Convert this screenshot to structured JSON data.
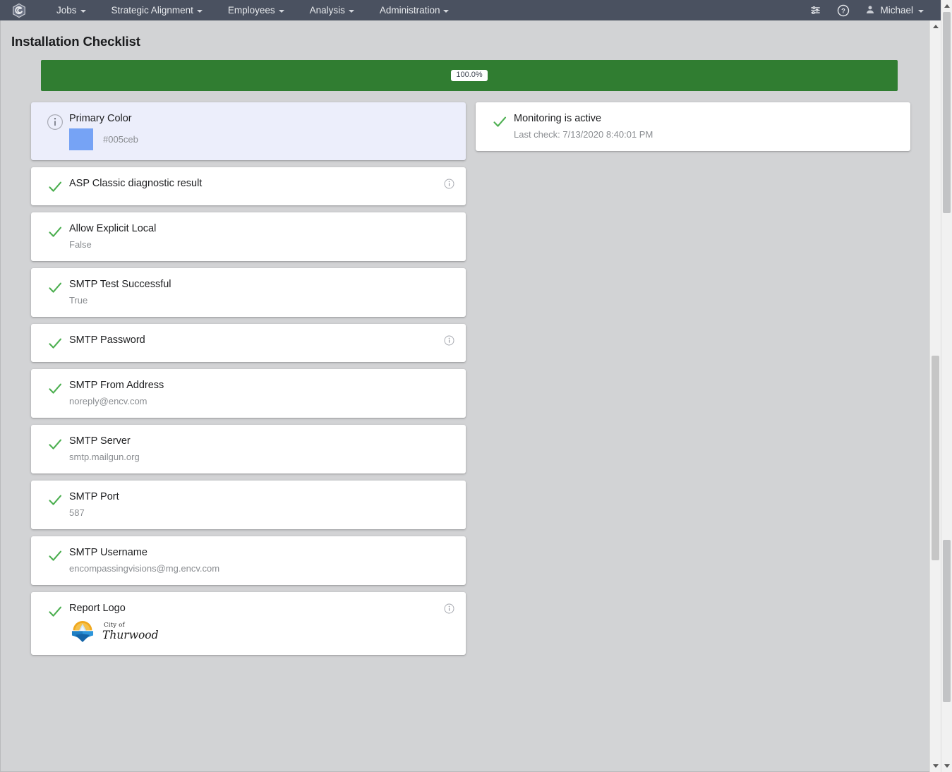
{
  "navbar": {
    "brand_icon": "hexagon-swirl-logo",
    "menus": [
      {
        "label": "Jobs",
        "icon": "chevron-down-icon"
      },
      {
        "label": "Strategic Alignment",
        "icon": "chevron-down-icon"
      },
      {
        "label": "Employees",
        "icon": "chevron-down-icon"
      },
      {
        "label": "Analysis",
        "icon": "chevron-down-icon"
      },
      {
        "label": "Administration",
        "icon": "chevron-down-icon"
      }
    ],
    "settings_icon": "sliders-icon",
    "help_icon": "help-circle-icon",
    "user": {
      "avatar_icon": "user-avatar-icon",
      "name": "Michael",
      "caret_icon": "chevron-down-icon"
    }
  },
  "page": {
    "title": "Installation Checklist"
  },
  "progress": {
    "label": "100.0%",
    "percent": 100,
    "bar_color": "#307d31",
    "badge_bg": "#ffffff"
  },
  "left_column": [
    {
      "name": "primary-color",
      "status_icon": "info-circle-icon",
      "title": "Primary Color",
      "value": "#005ceb",
      "swatch_color": "#76a3f5",
      "highlighted": true,
      "has_info": false
    },
    {
      "name": "asp-classic-diagnostic-result",
      "status_icon": "check-icon",
      "title": "ASP Classic diagnostic result",
      "value": "",
      "highlighted": false,
      "has_info": true
    },
    {
      "name": "allow-explicit-local",
      "status_icon": "check-icon",
      "title": "Allow Explicit Local",
      "value": "False",
      "highlighted": false,
      "has_info": false
    },
    {
      "name": "smtp-test-successful",
      "status_icon": "check-icon",
      "title": "SMTP Test Successful",
      "value": "True",
      "highlighted": false,
      "has_info": false
    },
    {
      "name": "smtp-password",
      "status_icon": "check-icon",
      "title": "SMTP Password",
      "value": "",
      "highlighted": false,
      "has_info": true
    },
    {
      "name": "smtp-from-address",
      "status_icon": "check-icon",
      "title": "SMTP From Address",
      "value": "noreply@encv.com",
      "highlighted": false,
      "has_info": false
    },
    {
      "name": "smtp-server",
      "status_icon": "check-icon",
      "title": "SMTP Server",
      "value": "smtp.mailgun.org",
      "highlighted": false,
      "has_info": false
    },
    {
      "name": "smtp-port",
      "status_icon": "check-icon",
      "title": "SMTP Port",
      "value": "587",
      "highlighted": false,
      "has_info": false
    },
    {
      "name": "smtp-username",
      "status_icon": "check-icon",
      "title": "SMTP Username",
      "value": "encompassingvisions@mg.encv.com",
      "highlighted": false,
      "has_info": false
    },
    {
      "name": "report-logo",
      "status_icon": "check-icon",
      "title": "Report Logo",
      "value": "",
      "highlighted": false,
      "has_info": true,
      "logo": {
        "icon": "city-of-thurwood-logo",
        "line1": "City of",
        "line2": "Thurwood"
      }
    }
  ],
  "right_column": [
    {
      "name": "monitoring-status",
      "status_icon": "check-icon",
      "title": "Monitoring is active",
      "value": "Last check: 7/13/2020 8:40:01 PM",
      "highlighted": false,
      "has_info": false
    }
  ],
  "scrollbars": {
    "outer": {
      "up_icon": "scroll-up-arrow",
      "down_icon": "scroll-down-arrow"
    },
    "inner": {
      "up_icon": "scroll-up-arrow",
      "down_icon": "scroll-down-arrow"
    }
  }
}
